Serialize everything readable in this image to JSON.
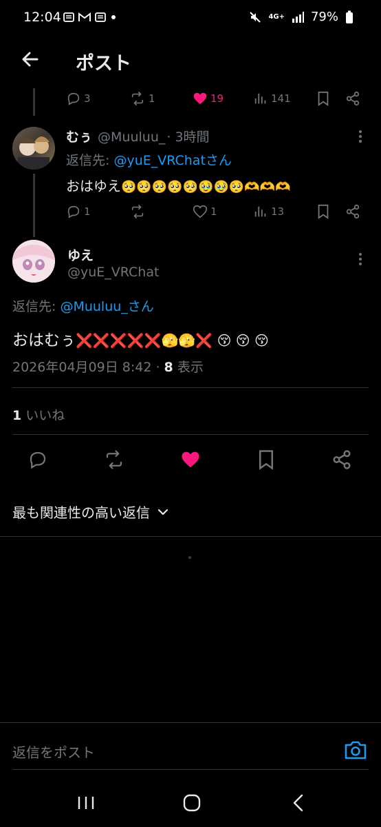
{
  "status_bar": {
    "time": "12:04",
    "network": "4G+",
    "battery": "79%"
  },
  "header": {
    "title": "ポスト"
  },
  "parent_actions": {
    "replies": "3",
    "reposts": "1",
    "likes": "19",
    "views": "141"
  },
  "reply_tweet": {
    "name": "むぅ",
    "handle": "@Muuluu_",
    "time": "· 3時間",
    "reply_to_prefix": "返信先: ",
    "reply_to_handle": "@yuE_VRChatさん",
    "text": "おはゆえ",
    "emoji": "🥺🥺🥺🥺🥺🥹🥹🥺🫶🫶🫶",
    "replies": "1",
    "reposts": "",
    "likes": "1",
    "views": "13"
  },
  "main_tweet": {
    "name": "ゆえ",
    "handle": "@yuE_VRChat",
    "reply_to_prefix": "返信先: ",
    "reply_to_handle": "@Muuluu_さん",
    "text": "おはむぅ",
    "emoji": "❌❌❌❌❌🫣🫣❌ 😚 😚 😚",
    "date": "2026年04月09日 8:42",
    "dot": " · ",
    "views_count": "8",
    "views_label": " 表示",
    "likes_count": "1",
    "likes_label": " いいね"
  },
  "sort": {
    "label": "最も関連性の高い返信"
  },
  "compose": {
    "placeholder": "返信をポスト"
  },
  "colors": {
    "accent": "#1d9bf0",
    "like": "#f91880",
    "muted": "#71767b"
  }
}
